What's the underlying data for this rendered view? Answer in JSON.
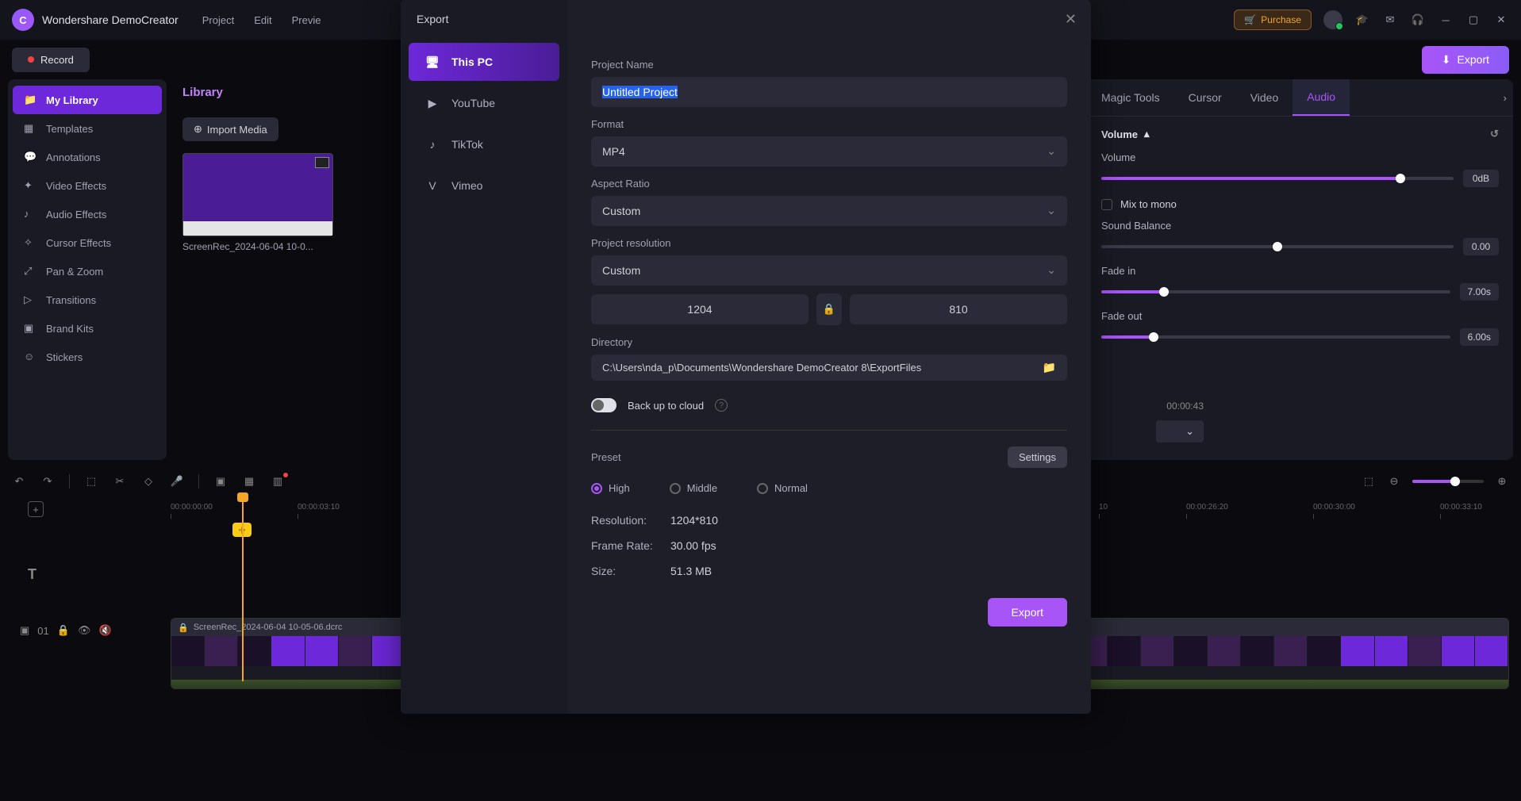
{
  "app": {
    "title": "Wondershare DemoCreator"
  },
  "topmenu": [
    "Project",
    "Edit",
    "Previe"
  ],
  "purchase": "Purchase",
  "record": "Record",
  "export_main": "Export",
  "sidebar": {
    "items": [
      {
        "label": "My Library",
        "active": true
      },
      {
        "label": "Templates"
      },
      {
        "label": "Annotations"
      },
      {
        "label": "Video Effects"
      },
      {
        "label": "Audio Effects"
      },
      {
        "label": "Cursor Effects"
      },
      {
        "label": "Pan & Zoom"
      },
      {
        "label": "Transitions"
      },
      {
        "label": "Brand Kits"
      },
      {
        "label": "Stickers"
      }
    ]
  },
  "library": {
    "tab": "Library",
    "import": "Import Media",
    "media_name": "ScreenRec_2024-06-04 10-0..."
  },
  "preview": {
    "time": "00:00:43"
  },
  "props": {
    "tabs": [
      "Magic Tools",
      "Cursor",
      "Video",
      "Audio"
    ],
    "active_tab": "Audio",
    "section": "Volume",
    "volume_label": "Volume",
    "volume_val": "0dB",
    "mix_mono": "Mix to mono",
    "balance_label": "Sound Balance",
    "balance_val": "0.00",
    "fadein_label": "Fade in",
    "fadein_val": "7.00s",
    "fadeout_label": "Fade out",
    "fadeout_val": "6.00s"
  },
  "timeline": {
    "ticks": [
      "00:00:00:00",
      "00:00:03:10",
      "10",
      "00:00:26:20",
      "00:00:30:00",
      "00:00:33:10"
    ],
    "clip_name": "ScreenRec_2024-06-04 10-05-06.dcrc",
    "track_num": "01"
  },
  "modal": {
    "title": "Export",
    "dests": [
      {
        "label": "This PC",
        "active": true
      },
      {
        "label": "YouTube"
      },
      {
        "label": "TikTok"
      },
      {
        "label": "Vimeo"
      }
    ],
    "project_name_label": "Project Name",
    "project_name": "Untitled Project",
    "format_label": "Format",
    "format": "MP4",
    "aspect_label": "Aspect Ratio",
    "aspect": "Custom",
    "resolution_label": "Project resolution",
    "resolution": "Custom",
    "width": "1204",
    "height": "810",
    "directory_label": "Directory",
    "directory": "C:\\Users\\nda_p\\Documents\\Wondershare DemoCreator 8\\ExportFiles",
    "backup": "Back up to cloud",
    "preset_label": "Preset",
    "settings": "Settings",
    "preset_opts": [
      "High",
      "Middle",
      "Normal"
    ],
    "info": {
      "res_label": "Resolution:",
      "res_val": "1204*810",
      "fps_label": "Frame Rate:",
      "fps_val": "30.00 fps",
      "size_label": "Size:",
      "size_val": "51.3 MB"
    },
    "export_btn": "Export"
  }
}
